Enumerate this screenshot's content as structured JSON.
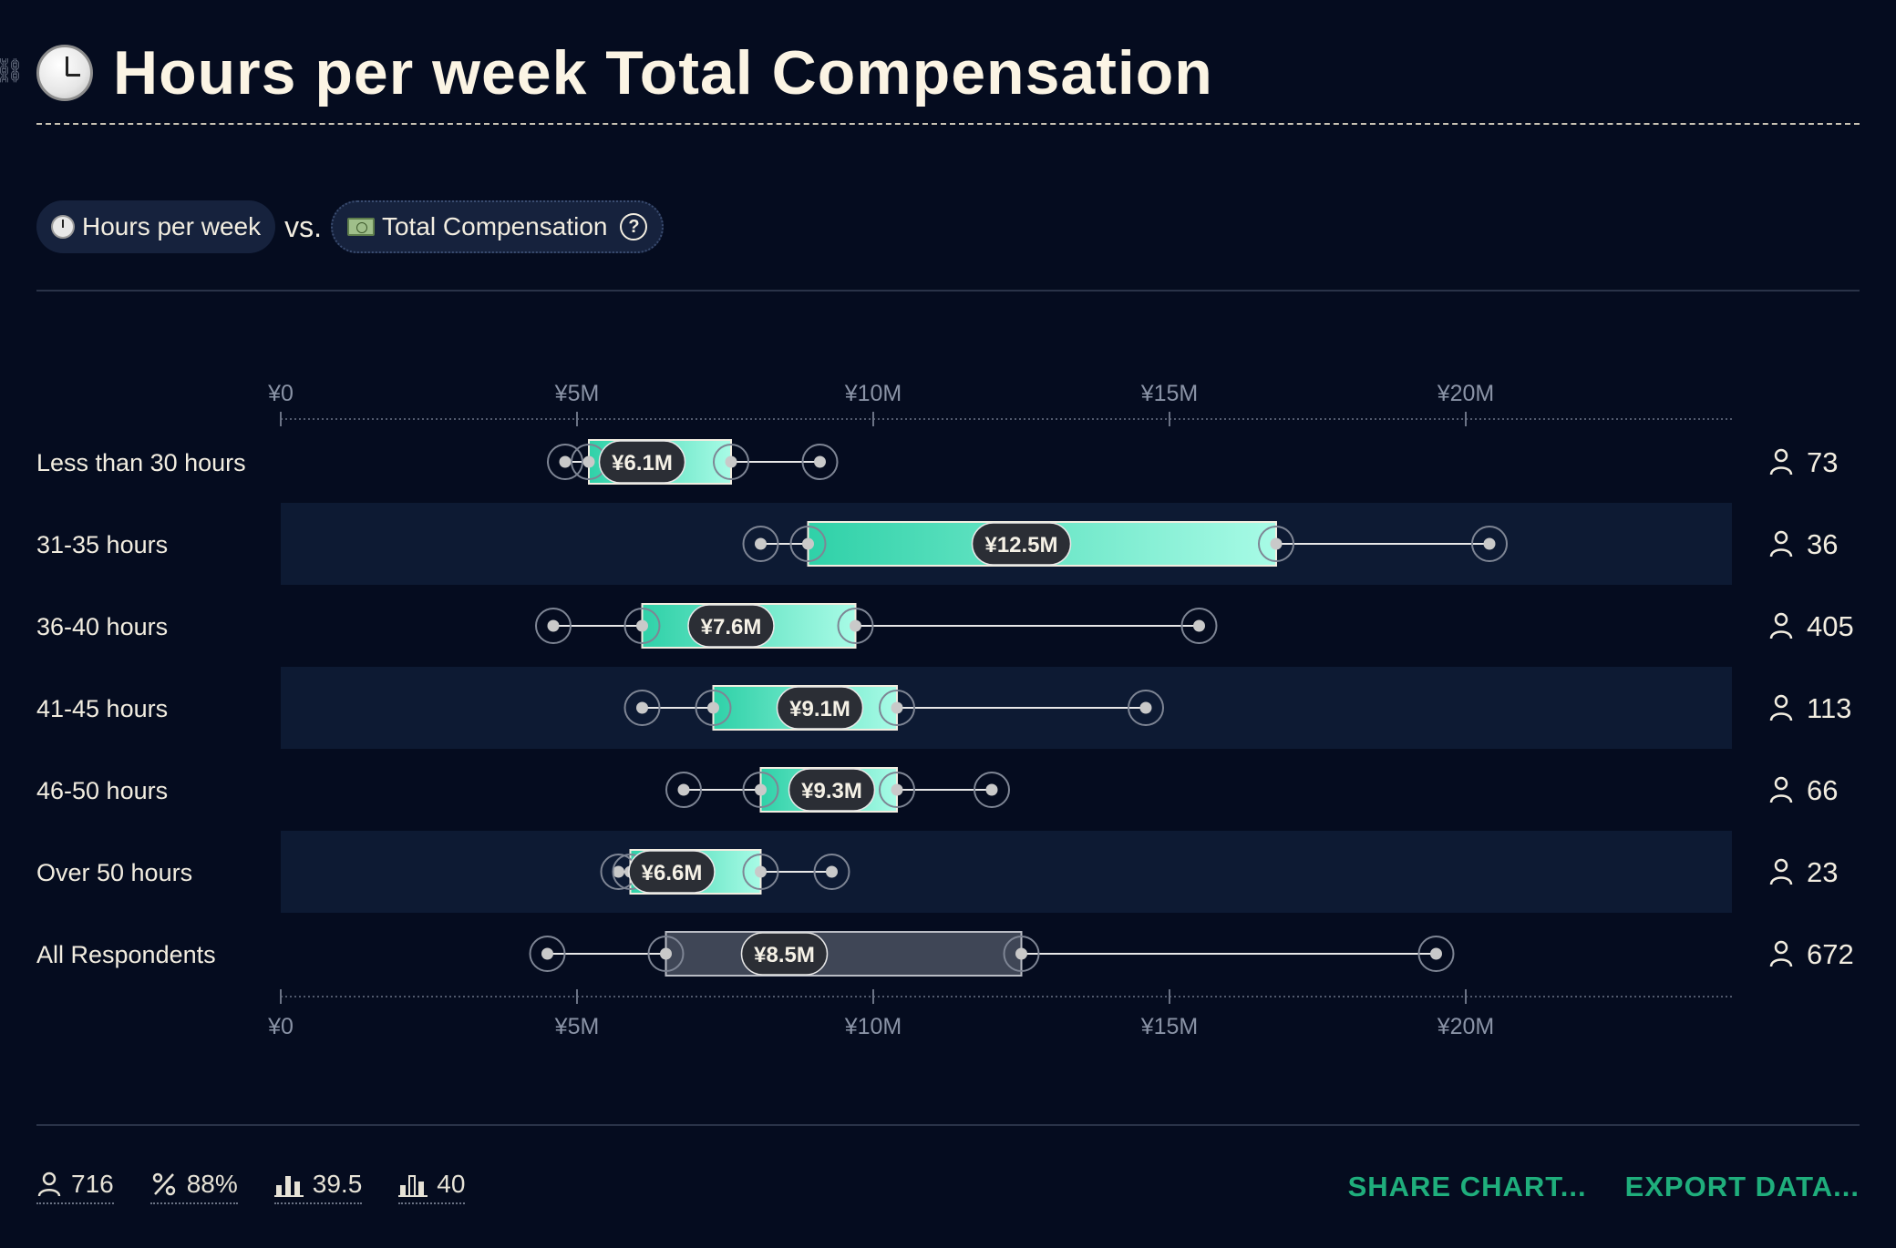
{
  "title": "Hours per week Total Compensation",
  "filter": {
    "left_label": "Hours per week",
    "vs_label": "vs.",
    "right_label": "Total Compensation"
  },
  "icons": [
    "link-icon",
    "clock-icon",
    "money-icon",
    "help-icon",
    "person-icon",
    "percent-icon",
    "mean-icon",
    "median-icon"
  ],
  "colors": {
    "background": "#050c1f",
    "band": "#0d1a33",
    "box_start": "#2fd1a8",
    "box_end": "#a8fbe6",
    "all_box": "#3f4656",
    "accent": "#1fae7c"
  },
  "chart_data": {
    "type": "boxplot",
    "currency": "¥",
    "x_ticks": [
      "¥0",
      "¥5M",
      "¥10M",
      "¥15M",
      "¥20M"
    ],
    "xlim": [
      0,
      24.5
    ],
    "unit": "M",
    "rows": [
      {
        "label": "Less than 30 hours",
        "whisker_low": 4.8,
        "q1": 5.2,
        "median": 6.1,
        "median_label": "¥6.1M",
        "q3": 7.6,
        "whisker_high": 9.1,
        "count": "73",
        "band": false,
        "kind": "group"
      },
      {
        "label": "31-35 hours",
        "whisker_low": 8.1,
        "q1": 8.9,
        "median": 12.5,
        "median_label": "¥12.5M",
        "q3": 16.8,
        "whisker_high": 20.4,
        "count": "36",
        "band": true,
        "kind": "group"
      },
      {
        "label": "36-40 hours",
        "whisker_low": 4.6,
        "q1": 6.1,
        "median": 7.6,
        "median_label": "¥7.6M",
        "q3": 9.7,
        "whisker_high": 15.5,
        "count": "405",
        "band": false,
        "kind": "group"
      },
      {
        "label": "41-45 hours",
        "whisker_low": 6.1,
        "q1": 7.3,
        "median": 9.1,
        "median_label": "¥9.1M",
        "q3": 10.4,
        "whisker_high": 14.6,
        "count": "113",
        "band": true,
        "kind": "group"
      },
      {
        "label": "46-50 hours",
        "whisker_low": 6.8,
        "q1": 8.1,
        "median": 9.3,
        "median_label": "¥9.3M",
        "q3": 10.4,
        "whisker_high": 12.0,
        "count": "66",
        "band": false,
        "kind": "group"
      },
      {
        "label": "Over 50 hours",
        "whisker_low": 5.7,
        "q1": 5.9,
        "median": 6.6,
        "median_label": "¥6.6M",
        "q3": 8.1,
        "whisker_high": 9.3,
        "count": "23",
        "band": true,
        "kind": "group"
      },
      {
        "label": "All Respondents",
        "whisker_low": 4.5,
        "q1": 6.5,
        "median": 8.5,
        "median_label": "¥8.5M",
        "q3": 12.5,
        "whisker_high": 19.5,
        "count": "672",
        "band": false,
        "kind": "all"
      }
    ]
  },
  "footer": {
    "respondents": "716",
    "percent": "88%",
    "mean": "39.5",
    "median": "40",
    "share_label": "SHARE CHART...",
    "export_label": "EXPORT DATA..."
  }
}
